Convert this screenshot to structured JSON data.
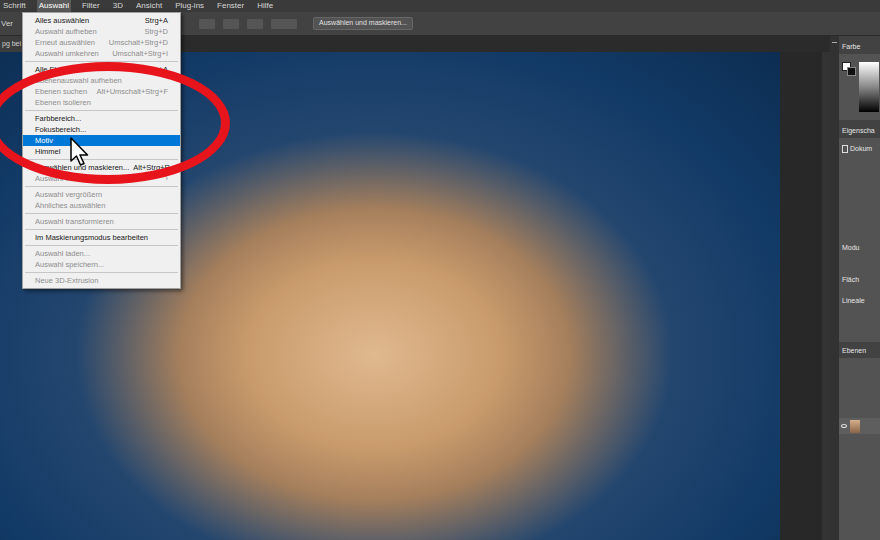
{
  "menubar": {
    "items": [
      {
        "label": "Schrift",
        "selected": false
      },
      {
        "label": "Auswahl",
        "selected": true
      },
      {
        "label": "Filter",
        "selected": false
      },
      {
        "label": "3D",
        "selected": false
      },
      {
        "label": "Ansicht",
        "selected": false
      },
      {
        "label": "Plug-ins",
        "selected": false
      },
      {
        "label": "Fenster",
        "selected": false
      },
      {
        "label": "Hilfe",
        "selected": false
      }
    ]
  },
  "options_bar": {
    "tool_label": "Ver",
    "button": "Auswählen und maskieren..."
  },
  "document_tab": {
    "label": "pg bei"
  },
  "menu": {
    "items": [
      {
        "kind": "item",
        "label": "Alles auswählen",
        "shortcut": "Strg+A",
        "disabled": false,
        "selected": false
      },
      {
        "kind": "item",
        "label": "Auswahl aufheben",
        "shortcut": "Strg+D",
        "disabled": true,
        "selected": false
      },
      {
        "kind": "item",
        "label": "Erneut auswählen",
        "shortcut": "Umschalt+Strg+D",
        "disabled": true,
        "selected": false
      },
      {
        "kind": "item",
        "label": "Auswahl umkehren",
        "shortcut": "Umschalt+Strg+I",
        "disabled": true,
        "selected": false
      },
      {
        "kind": "separator"
      },
      {
        "kind": "item",
        "label": "Alle Ebenen",
        "shortcut": "Alt+Strg+A",
        "disabled": false,
        "selected": false
      },
      {
        "kind": "item",
        "label": "Ebenenauswahl aufheben",
        "shortcut": "",
        "disabled": true,
        "selected": false
      },
      {
        "kind": "item",
        "label": "Ebenen suchen",
        "shortcut": "Alt+Umschalt+Strg+F",
        "disabled": true,
        "selected": false
      },
      {
        "kind": "item",
        "label": "Ebenen isolieren",
        "shortcut": "",
        "disabled": true,
        "selected": false
      },
      {
        "kind": "separator"
      },
      {
        "kind": "item",
        "label": "Farbbereich...",
        "shortcut": "",
        "disabled": false,
        "selected": false
      },
      {
        "kind": "item",
        "label": "Fokusbereich...",
        "shortcut": "",
        "disabled": false,
        "selected": false
      },
      {
        "kind": "item",
        "label": "Motiv",
        "shortcut": "",
        "disabled": false,
        "selected": true
      },
      {
        "kind": "item",
        "label": "Himmel",
        "shortcut": "",
        "disabled": false,
        "selected": false
      },
      {
        "kind": "separator"
      },
      {
        "kind": "item",
        "label": "Auswählen und maskieren...",
        "shortcut": "Alt+Strg+R",
        "disabled": false,
        "selected": false
      },
      {
        "kind": "item",
        "label": "Auswahl verändern",
        "shortcut": "›",
        "disabled": true,
        "selected": false
      },
      {
        "kind": "separator"
      },
      {
        "kind": "item",
        "label": "Auswahl vergrößern",
        "shortcut": "",
        "disabled": true,
        "selected": false
      },
      {
        "kind": "item",
        "label": "Ähnliches auswählen",
        "shortcut": "",
        "disabled": true,
        "selected": false
      },
      {
        "kind": "separator"
      },
      {
        "kind": "item",
        "label": "Auswahl transformieren",
        "shortcut": "",
        "disabled": true,
        "selected": false
      },
      {
        "kind": "separator"
      },
      {
        "kind": "item",
        "label": "Im Maskierungsmodus bearbeiten",
        "shortcut": "",
        "disabled": false,
        "selected": false
      },
      {
        "kind": "separator"
      },
      {
        "kind": "item",
        "label": "Auswahl laden...",
        "shortcut": "",
        "disabled": true,
        "selected": false
      },
      {
        "kind": "item",
        "label": "Auswahl speichern...",
        "shortcut": "",
        "disabled": true,
        "selected": false
      },
      {
        "kind": "separator"
      },
      {
        "kind": "item",
        "label": "Neue 3D-Extrusion",
        "shortcut": "",
        "disabled": true,
        "selected": false
      }
    ]
  },
  "panels": {
    "color": {
      "label": "Farbe"
    },
    "properties": {
      "label": "Eigenscha",
      "document": "Dokum",
      "mode": "Modu",
      "fill": "Fläch",
      "rulers": "Lineale"
    },
    "layers": {
      "label": "Ebenen"
    }
  }
}
